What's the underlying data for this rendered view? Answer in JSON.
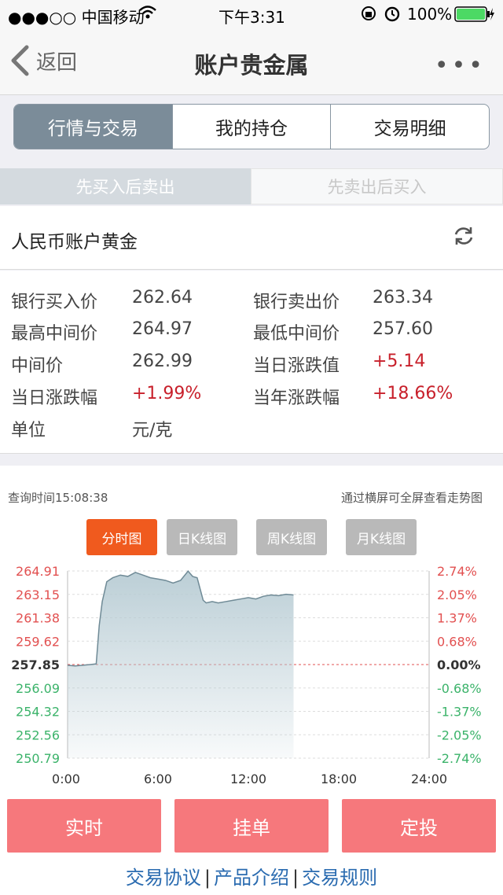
{
  "status_bar": {
    "carrier": "●●●○○ 中国移动",
    "time": "下午3:31",
    "battery": "100%"
  },
  "nav": {
    "back_label": "返回",
    "title": "账户贵金属",
    "more_label": "•••"
  },
  "segment_tabs": [
    "行情与交易",
    "我的持仓",
    "交易明细"
  ],
  "sub_tabs": [
    "先买入后卖出",
    "先卖出后买入"
  ],
  "product": {
    "name": "人民币账户黄金"
  },
  "prices": [
    {
      "label": "银行买入价",
      "value": "262.64",
      "label2": "银行卖出价",
      "value2": "263.34"
    },
    {
      "label": "最高中间价",
      "value": "264.97",
      "label2": "最低中间价",
      "value2": "257.60"
    },
    {
      "label": "中间价",
      "value": "262.99",
      "label2": "当日涨跌值",
      "value2": "+5.14"
    },
    {
      "label": "当日涨跌幅",
      "value": "+1.99%",
      "label2": "当年涨跌幅",
      "value2": "+18.66%"
    },
    {
      "label": "单位",
      "value": "元/克"
    }
  ],
  "chart_panel": {
    "query_time": "查询时间15:08:38",
    "hint": "通过横屏可全屏查看走势图",
    "buttons": [
      "分时图",
      "日K线图",
      "周K线图",
      "月K线图"
    ]
  },
  "chart_data": {
    "type": "area",
    "y_ticks": [
      "264.91",
      "263.15",
      "261.38",
      "259.62",
      "257.85",
      "256.09",
      "254.32",
      "252.56",
      "250.79"
    ],
    "pct_ticks": [
      "2.74%",
      "2.05%",
      "1.37%",
      "0.68%",
      "0.00%",
      "-0.68%",
      "-1.37%",
      "-2.05%",
      "-2.74%"
    ],
    "x_ticks": [
      "0:00",
      "6:00",
      "12:00",
      "18:00",
      "24:00"
    ],
    "ylim": [
      250.79,
      264.91
    ],
    "xlim": [
      0,
      24
    ],
    "baseline": 257.85,
    "x": [
      0,
      0.5,
      1,
      1.5,
      1.9,
      2.1,
      2.3,
      2.6,
      3.0,
      3.5,
      4.0,
      4.5,
      5.0,
      5.5,
      6.0,
      6.5,
      7.0,
      7.5,
      8.0,
      8.3,
      8.6,
      9.0,
      9.2,
      9.6,
      10.0,
      10.5,
      11.0,
      11.5,
      12.0,
      12.5,
      13.0,
      13.5,
      14.0,
      14.5,
      15.0
    ],
    "y": [
      257.8,
      257.75,
      257.8,
      257.85,
      257.9,
      260.8,
      262.6,
      264.1,
      264.4,
      264.6,
      264.5,
      264.8,
      264.6,
      264.4,
      264.3,
      264.2,
      264.0,
      264.2,
      264.9,
      264.5,
      264.4,
      262.7,
      262.5,
      262.6,
      262.5,
      262.6,
      262.7,
      262.8,
      262.9,
      262.8,
      263.0,
      263.1,
      263.05,
      263.15,
      263.1
    ],
    "area_color": "#b8ccd4",
    "line_color": "#6f8a96",
    "up_color": "#e25050",
    "down_color": "#3bb36a"
  },
  "actions": [
    "实时",
    "挂单",
    "定投"
  ],
  "footer_links": [
    "交易协议",
    "产品介绍",
    "交易规则"
  ]
}
